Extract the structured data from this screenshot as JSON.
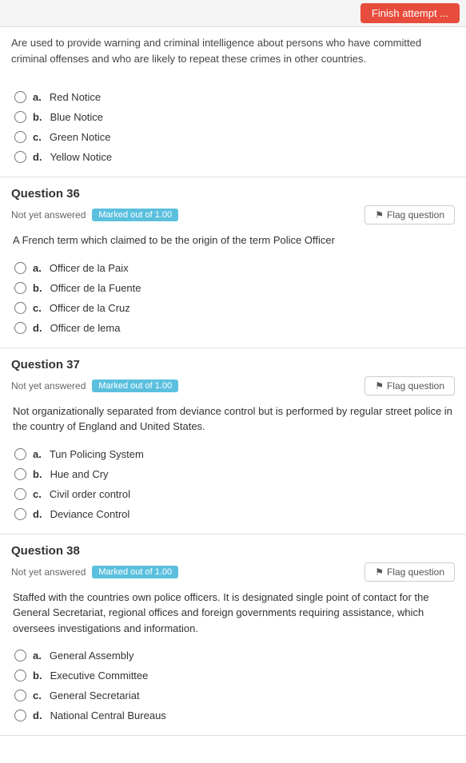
{
  "topBar": {
    "finishLabel": "Finish attempt ..."
  },
  "introSection": {
    "text": "Are used to provide warning and criminal intelligence about persons who have committed criminal offenses and who are likely to repeat these crimes in other countries."
  },
  "questions": [
    {
      "id": "q35_options",
      "options": [
        {
          "letter": "a.",
          "text": "Red Notice"
        },
        {
          "letter": "b.",
          "text": "Blue Notice"
        },
        {
          "letter": "c.",
          "text": "Green Notice"
        },
        {
          "letter": "d.",
          "text": "Yellow Notice"
        }
      ]
    },
    {
      "id": "q36",
      "title": "Question 36",
      "notAnswered": "Not yet answered",
      "marked": "Marked out of 1.00",
      "flagLabel": "Flag question",
      "text": "A French term which claimed to be the origin of the term Police Officer",
      "options": [
        {
          "letter": "a.",
          "text": "Officer de la Paix"
        },
        {
          "letter": "b.",
          "text": "Officer de la Fuente"
        },
        {
          "letter": "c.",
          "text": "Officer de la Cruz"
        },
        {
          "letter": "d.",
          "text": "Officer de lema"
        }
      ]
    },
    {
      "id": "q37",
      "title": "Question 37",
      "notAnswered": "Not yet answered",
      "marked": "Marked out of 1.00",
      "flagLabel": "Flag question",
      "text": "Not organizationally separated from deviance control but is performed by regular street police in the country of England and United States.",
      "options": [
        {
          "letter": "a.",
          "text": "Tun Policing System"
        },
        {
          "letter": "b.",
          "text": "Hue and Cry"
        },
        {
          "letter": "c.",
          "text": "Civil order control"
        },
        {
          "letter": "d.",
          "text": "Deviance Control"
        }
      ]
    },
    {
      "id": "q38",
      "title": "Question 38",
      "notAnswered": "Not yet answered",
      "marked": "Marked out of 1.00",
      "flagLabel": "Flag question",
      "text": "Staffed with the countries own police officers. It is designated single point of contact for the General Secretariat, regional offices and foreign governments requiring assistance, which oversees investigations and information.",
      "options": [
        {
          "letter": "a.",
          "text": "General Assembly"
        },
        {
          "letter": "b.",
          "text": "Executive Committee"
        },
        {
          "letter": "c.",
          "text": "General Secretariat"
        },
        {
          "letter": "d.",
          "text": "National Central Bureaus"
        }
      ]
    }
  ]
}
